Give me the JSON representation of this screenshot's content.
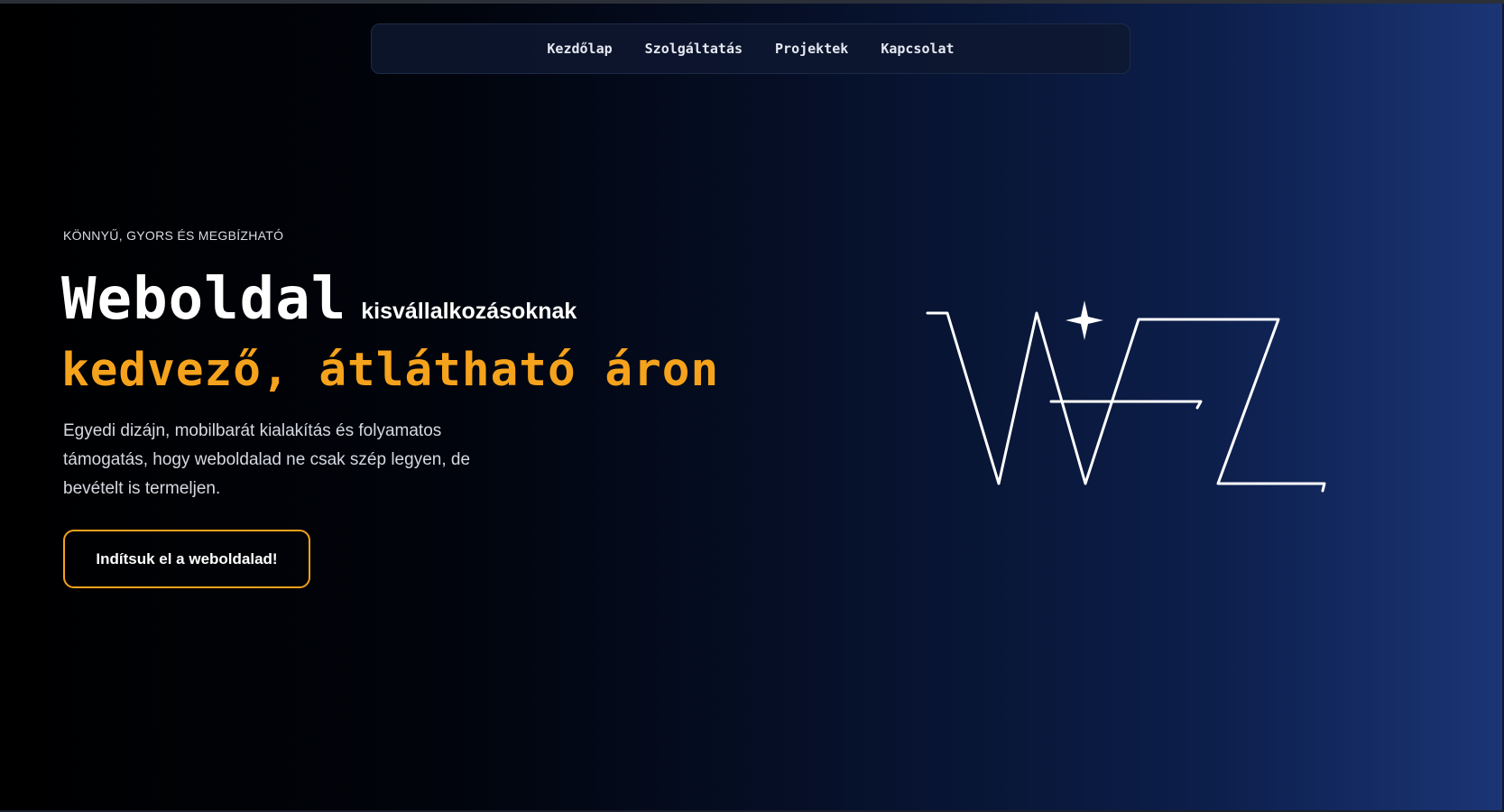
{
  "nav": {
    "items": [
      "Kezdőlap",
      "Szolgáltatás",
      "Projektek",
      "Kapcsolat"
    ]
  },
  "hero": {
    "eyebrow": "KÖNNYŰ, GYORS ÉS MEGBÍZHATÓ",
    "title_main": "Weboldal",
    "title_sub": "kisvállalkozásoknak",
    "title_accent": "kedvező, átlátható áron",
    "description": "Egyedi dizájn, mobilbarát kialakítás és folyamatos támogatás, hogy weboldalad ne csak szép legyen, de bevételt is termeljen.",
    "cta_label": "Indítsuk el a weboldalad!"
  },
  "colors": {
    "accent": "#f5a21c",
    "text": "#ffffff",
    "nav_bg": "#0e1830"
  },
  "logo": {
    "icon": "wfz-logo-icon"
  }
}
